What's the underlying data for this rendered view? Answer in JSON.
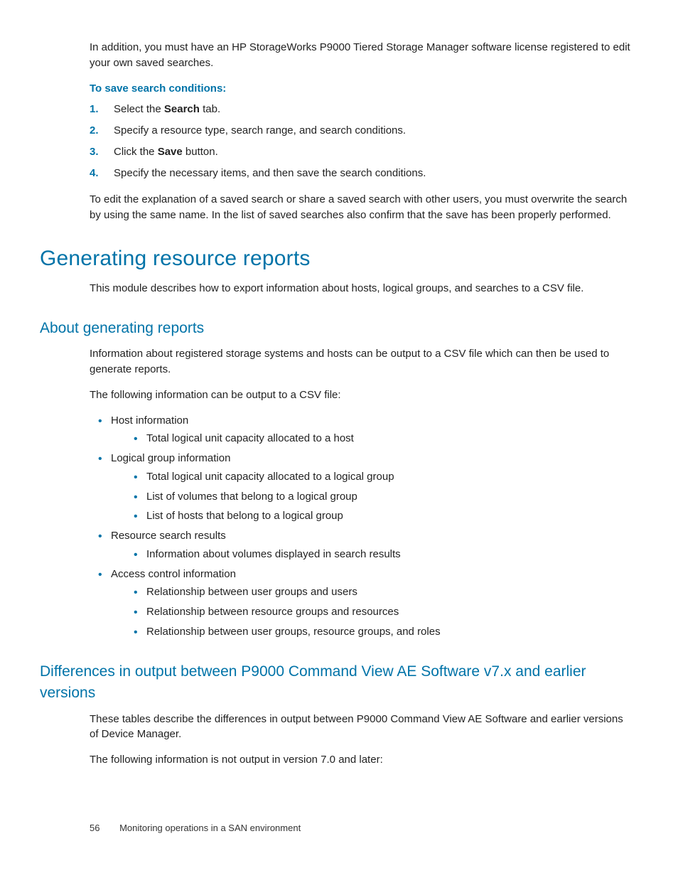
{
  "intro_license": "In addition, you must have an HP StorageWorks P9000 Tiered Storage Manager software license registered to edit your own saved searches.",
  "procedure": {
    "title": "To save search conditions:",
    "steps": [
      {
        "n": "1.",
        "pre": "Select the ",
        "bold": "Search",
        "post": " tab."
      },
      {
        "n": "2.",
        "pre": "Specify a resource type, search range, and search conditions.",
        "bold": "",
        "post": ""
      },
      {
        "n": "3.",
        "pre": "Click the ",
        "bold": "Save",
        "post": " button."
      },
      {
        "n": "4.",
        "pre": "Specify the necessary items, and then save the search conditions.",
        "bold": "",
        "post": ""
      }
    ]
  },
  "edit_para": "To edit the explanation of a saved search or share a saved search with other users, you must overwrite the search by using the same name. In the list of saved searches also confirm that the save has been properly performed.",
  "h1": "Generating resource reports",
  "h1_intro": "This module describes how to export information about hosts, logical groups, and searches to a CSV file.",
  "about": {
    "heading": "About generating reports",
    "p1": "Information about registered storage systems and hosts can be output to a CSV file which can then be used to generate reports.",
    "p2": "The following information can be output to a CSV file:",
    "items": [
      {
        "label": "Host information",
        "subs": [
          "Total logical unit capacity allocated to a host"
        ]
      },
      {
        "label": "Logical group information",
        "subs": [
          "Total logical unit capacity allocated to a logical group",
          "List of volumes that belong to a logical group",
          "List of hosts that belong to a logical group"
        ]
      },
      {
        "label": "Resource search results",
        "subs": [
          "Information about volumes displayed in search results"
        ]
      },
      {
        "label": "Access control information",
        "subs": [
          "Relationship between user groups and users",
          "Relationship between resource groups and resources",
          "Relationship between user groups, resource groups, and roles"
        ]
      }
    ]
  },
  "diff": {
    "heading": "Differences in output between P9000 Command View AE Software v7.x and earlier versions",
    "p1": "These tables describe the differences in output between P9000 Command View AE Software and earlier versions of Device Manager.",
    "p2": "The following information is not output in version 7.0 and later:"
  },
  "footer": {
    "page": "56",
    "chapter": "Monitoring operations in a SAN environment"
  }
}
